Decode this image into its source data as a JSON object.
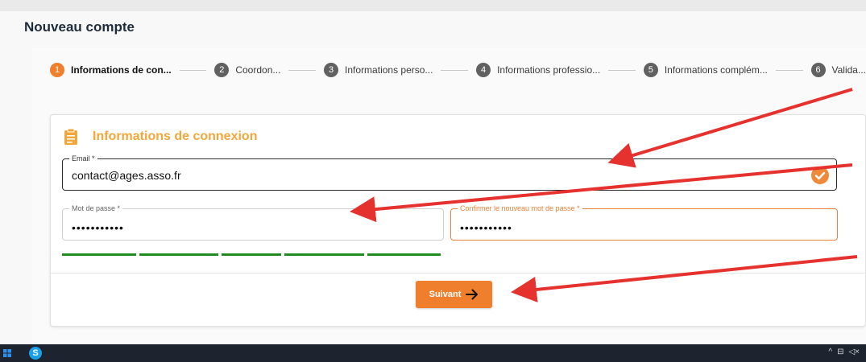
{
  "page": {
    "title": "Nouveau compte"
  },
  "steps": [
    {
      "num": "1",
      "label": "Informations de con...",
      "active": true
    },
    {
      "num": "2",
      "label": "Coordon..."
    },
    {
      "num": "3",
      "label": "Informations perso..."
    },
    {
      "num": "4",
      "label": "Informations professio..."
    },
    {
      "num": "5",
      "label": "Informations complém..."
    },
    {
      "num": "6",
      "label": "Valida..."
    }
  ],
  "card": {
    "title": "Informations de connexion",
    "icon": "clipboard-icon"
  },
  "form": {
    "email": {
      "label": "Email *",
      "value": "contact@ages.asso.fr",
      "valid": true
    },
    "password": {
      "label": "Mot de passe *",
      "value": "•••••••••••"
    },
    "confirm": {
      "label": "Confirmer le nouveau mot de passe *",
      "value": "•••••••••••"
    },
    "strength_segments_filled": 5,
    "strength_segments_total": 5
  },
  "buttons": {
    "next": {
      "label": "Suivant",
      "icon": "arrow-right-icon"
    }
  },
  "taskbar": {
    "skype_letter": "S",
    "tray": [
      "^",
      "⊟",
      "◁×"
    ]
  },
  "colors": {
    "accent": "#ef7f2c",
    "title": "#f2a73b",
    "strength": "#1f8c1f",
    "annotation_arrow": "#e5322e"
  }
}
